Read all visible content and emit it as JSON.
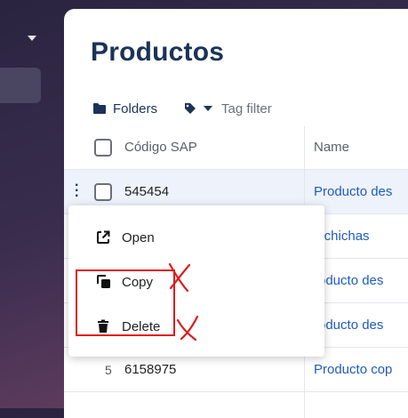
{
  "page": {
    "title": "Productos"
  },
  "toolbar": {
    "folders_label": "Folders",
    "tag_filter_label": "Tag filter"
  },
  "table": {
    "headers": {
      "code": "Código SAP",
      "name": "Name"
    },
    "rows": [
      {
        "index": "",
        "code": "545454",
        "name": "Producto des"
      },
      {
        "index": "",
        "code": "",
        "name": "alchichas"
      },
      {
        "index": "",
        "code": "",
        "name": "roducto des"
      },
      {
        "index": "",
        "code": "",
        "name": "roducto des"
      },
      {
        "index": "5",
        "code": "6158975",
        "name": "Producto cop"
      }
    ]
  },
  "context_menu": {
    "items": [
      {
        "label": "Open",
        "icon": "open-external-icon"
      },
      {
        "label": "Copy",
        "icon": "copy-icon"
      },
      {
        "label": "Delete",
        "icon": "trash-icon"
      }
    ]
  },
  "colors": {
    "title": "#1b3358",
    "link": "#1f5bbd",
    "annotation": "#e01b1b"
  }
}
